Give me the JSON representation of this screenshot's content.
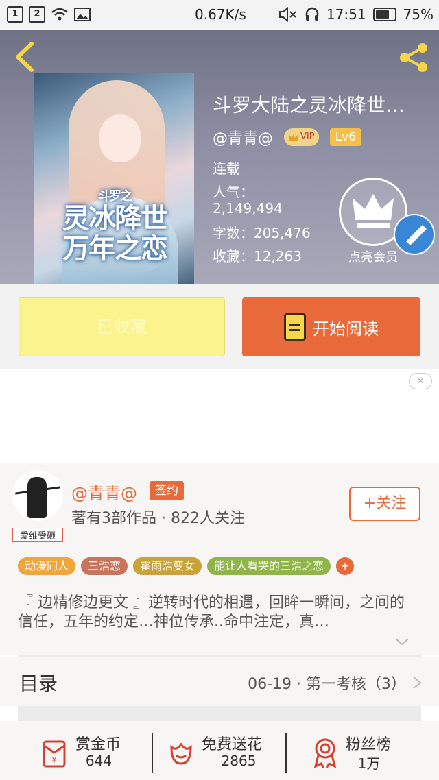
{
  "status_bar": {
    "sim1": "1",
    "sim2": "2",
    "speed": "0.67K/s",
    "time": "17:51",
    "battery": "75%",
    "battery_level": 0.75
  },
  "book": {
    "title": "斗罗大陆之灵冰降世…",
    "author": "@青青@",
    "vip_text": "VIP",
    "level": "Lv6",
    "status": "连载",
    "popularity_label": "人气：",
    "popularity_value": "2,149,494",
    "word_count": "字数：205,476",
    "favorites": "收藏：12,263",
    "cover_subtitle": "斗罗之",
    "cover_title_line1": "灵冰降世",
    "cover_title_line2": "万年之恋"
  },
  "vip_member": {
    "label": "点亮会员"
  },
  "actions": {
    "collected_label": "已收藏",
    "read_label": "开始阅读"
  },
  "ad": {
    "close_icon": "close-icon"
  },
  "author_card": {
    "avatar_tag": "爱维受砸",
    "name": "@青青@",
    "sign_badge": "签约",
    "works": "著有3部作品 · 822人关注",
    "follow_label": "+关注"
  },
  "tags": [
    {
      "label": "动漫同人",
      "color": "#f0a63a"
    },
    {
      "label": "三浩恋",
      "color": "#c8735c"
    },
    {
      "label": "霍雨浩变女",
      "color": "#c9a23a"
    },
    {
      "label": "能让人看哭的三浩之恋",
      "color": "#8fb548"
    }
  ],
  "tag_plus": "+",
  "synopsis": "『 边精修边更文 』逆转时代的相遇，回眸一瞬间，之间的信任，五年的约定…神位传承..命中注定，真…",
  "toc": {
    "label": "目录",
    "latest": "06-19 · 第一考核（3）"
  },
  "bottom": {
    "coins_label": "赏金币",
    "coins_count": "644",
    "flowers_label": "免费送花",
    "flowers_count": "2865",
    "fans_label": "粉丝榜",
    "fans_count": "1万"
  },
  "colors": {
    "accent": "#e8693a",
    "collected_bg": "#fbf48d",
    "hero_bg": "#8e8fa4"
  }
}
